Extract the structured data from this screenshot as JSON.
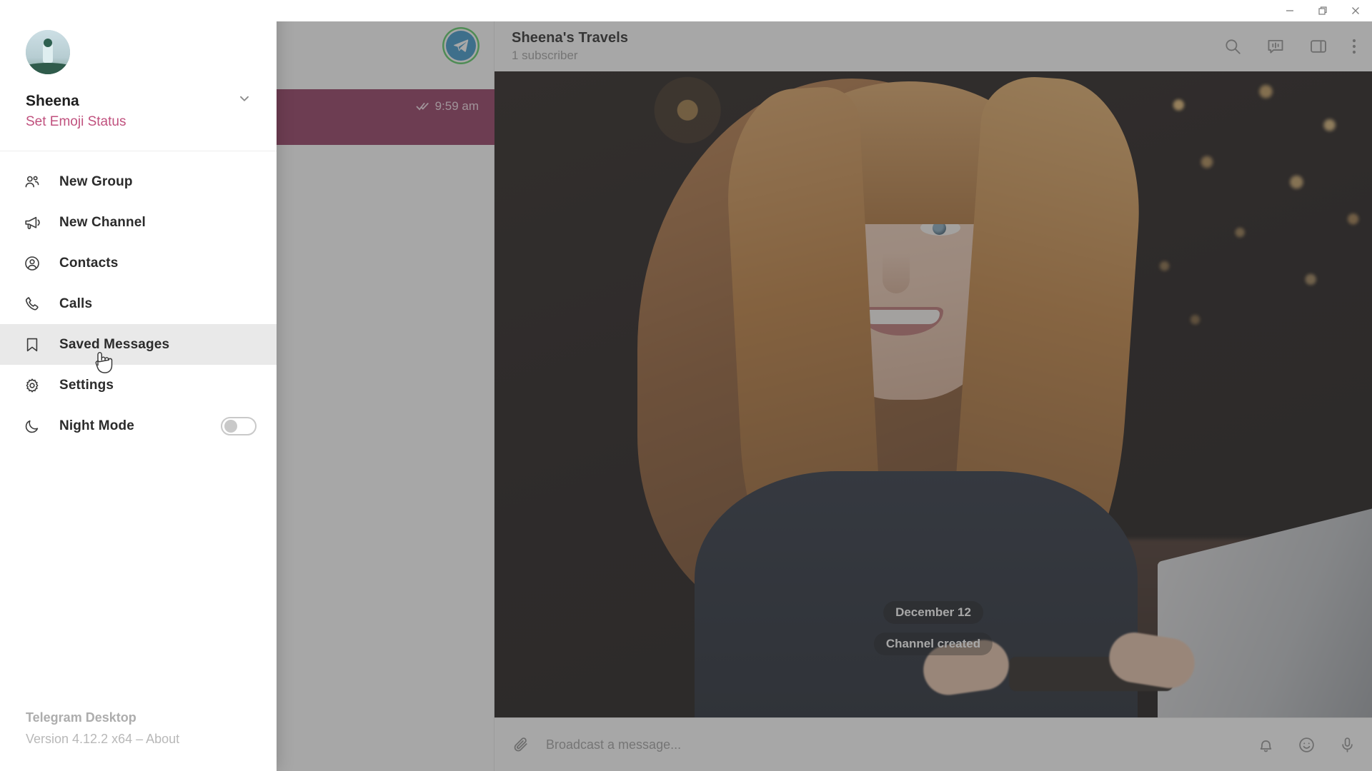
{
  "window": {
    "minimize_label": "Minimize",
    "restore_label": "Restore",
    "close_label": "Close"
  },
  "drawer": {
    "profile": {
      "name": "Sheena",
      "status_label": "Set Emoji Status",
      "avatar_name": "user-avatar",
      "chevron_icon": "chevron-down-icon"
    },
    "items": [
      {
        "label": "New Group",
        "icon": "group-icon",
        "active": false,
        "has_toggle": false
      },
      {
        "label": "New Channel",
        "icon": "megaphone-icon",
        "active": false,
        "has_toggle": false
      },
      {
        "label": "Contacts",
        "icon": "contact-circle-icon",
        "active": false,
        "has_toggle": false
      },
      {
        "label": "Calls",
        "icon": "phone-icon",
        "active": false,
        "has_toggle": false
      },
      {
        "label": "Saved Messages",
        "icon": "bookmark-icon",
        "active": true,
        "has_toggle": false
      },
      {
        "label": "Settings",
        "icon": "gear-icon",
        "active": false,
        "has_toggle": false
      },
      {
        "label": "Night Mode",
        "icon": "moon-icon",
        "active": false,
        "has_toggle": true,
        "toggle_state": "off"
      }
    ],
    "footer": {
      "app_name": "Telegram Desktop",
      "version": "Version 4.12.2 x64 – About"
    }
  },
  "chatlist": {
    "self_avatar_name": "telegram-logo-avatar",
    "selected_row": {
      "time": "9:59 am",
      "read_status_icon": "double-check-icon"
    }
  },
  "chat": {
    "title": "Sheena's Travels",
    "subtitle": "1 subscriber",
    "actions": [
      {
        "name": "search-icon",
        "label": "Search"
      },
      {
        "name": "live-stream-icon",
        "label": "Live Stream"
      },
      {
        "name": "toggle-panel-icon",
        "label": "Toggle Info Panel"
      },
      {
        "name": "more-options-icon",
        "label": "More"
      }
    ],
    "messages": {
      "date_divider": "December 12",
      "service_message": "Channel created"
    },
    "composer": {
      "attach_icon": "paperclip-icon",
      "placeholder": "Broadcast a message...",
      "actions": [
        {
          "name": "notification-bell-icon",
          "label": "Notifications"
        },
        {
          "name": "emoji-icon",
          "label": "Emoji"
        },
        {
          "name": "microphone-icon",
          "label": "Voice Message"
        }
      ]
    }
  },
  "colors": {
    "accent_pink": "#c0517e",
    "selected_row": "#8a2a55",
    "telegram_blue": "#2d8fc7",
    "story_ring": "#4ec95a",
    "menu_active": "#e9e9e9"
  }
}
